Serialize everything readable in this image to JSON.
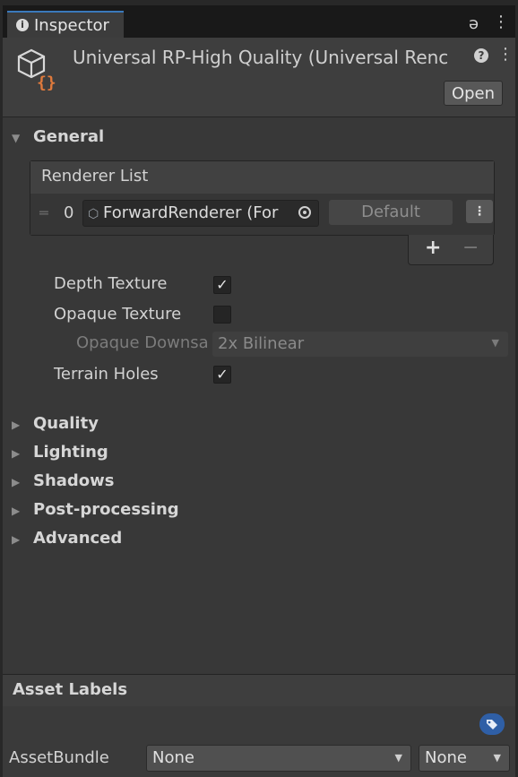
{
  "tab": {
    "info_icon": "info-icon",
    "label": "Inspector",
    "lock_icon": "lock-icon",
    "menu_icon": "more-icon"
  },
  "header": {
    "title": "Universal RP-High Quality (Universal Renc",
    "open_label": "Open",
    "help_icon": "help-icon",
    "menu_icon": "more-icon",
    "asset_icon": "scriptable-object-icon"
  },
  "general": {
    "title": "General",
    "renderer_list": {
      "title": "Renderer List",
      "items": [
        {
          "index": "0",
          "renderer": "ForwardRenderer (For",
          "default_label": "Default"
        }
      ],
      "add_label": "+",
      "remove_label": "−"
    },
    "depth_texture": {
      "label": "Depth Texture",
      "checked": true
    },
    "opaque_texture": {
      "label": "Opaque Texture",
      "checked": false
    },
    "opaque_downsampling": {
      "label": "Opaque Downsa",
      "value": "2x Bilinear",
      "enabled": false
    },
    "terrain_holes": {
      "label": "Terrain Holes",
      "checked": true
    }
  },
  "sections": {
    "quality": "Quality",
    "lighting": "Lighting",
    "shadows": "Shadows",
    "post_processing": "Post-processing",
    "advanced": "Advanced"
  },
  "asset_labels": {
    "title": "Asset Labels",
    "tag_icon": "tag-icon"
  },
  "asset_bundle": {
    "label": "AssetBundle",
    "name_value": "None",
    "variant_value": "None"
  },
  "colors": {
    "background": "#383838",
    "header": "#3e3e3e",
    "tab_accent": "#3a79bb",
    "tag_blue": "#2f5fa6"
  }
}
